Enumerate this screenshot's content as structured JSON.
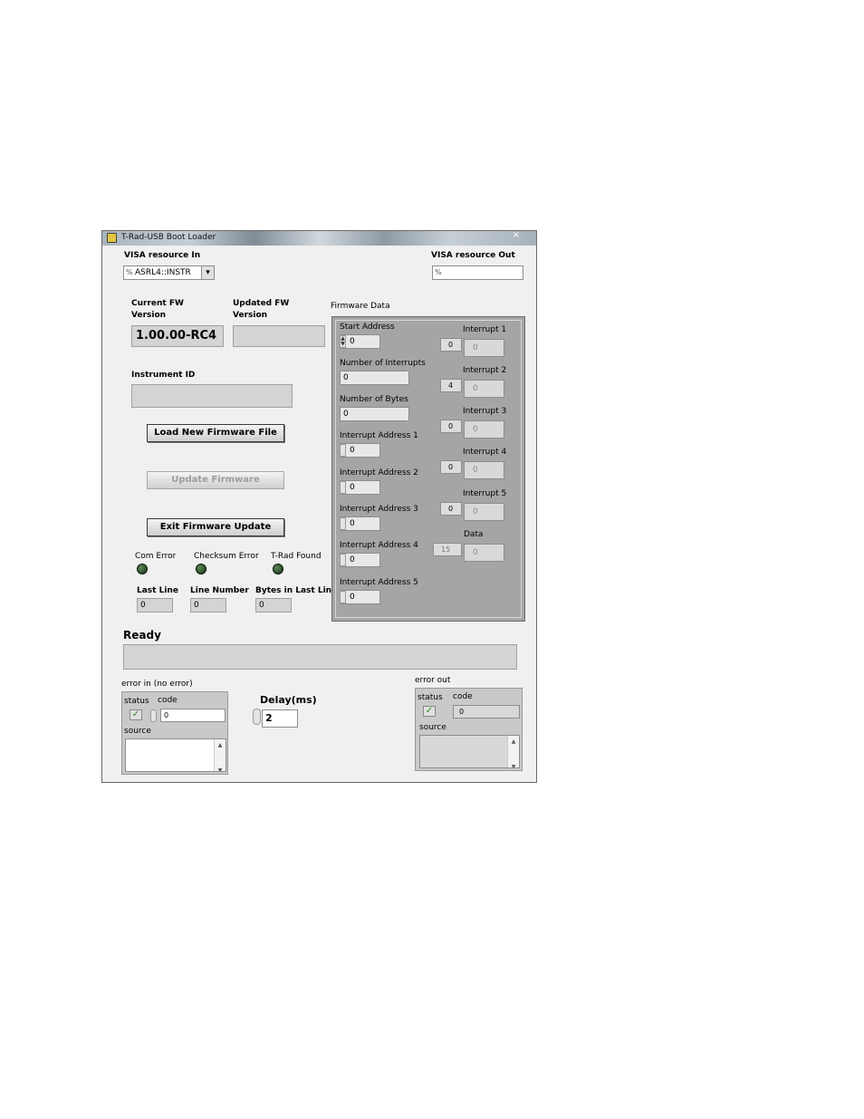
{
  "window": {
    "title": "T-Rad-USB Boot Loader",
    "close_glyph": "×"
  },
  "visa_in": {
    "label": "VISA resource In",
    "value": "ASRL4::INSTR",
    "prefix_icon": "io-resource-icon",
    "dropdown_glyph": "▾"
  },
  "visa_out": {
    "label": "VISA resource Out",
    "value": ""
  },
  "current_fw": {
    "label_line1": "Current FW",
    "label_line2": "Version",
    "value": "1.00.00-RC4"
  },
  "updated_fw": {
    "label_line1": "Updated FW",
    "label_line2": "Version",
    "value": ""
  },
  "instrument_id": {
    "label": "Instrument ID",
    "value": ""
  },
  "buttons": {
    "load": "Load New Firmware File",
    "update": "Update Firmware",
    "exit": "Exit Firmware Update"
  },
  "leds": [
    {
      "label": "Com Error"
    },
    {
      "label": "Checksum Error"
    },
    {
      "label": "T-Rad Found"
    }
  ],
  "counters": [
    {
      "label": "Last Line",
      "value": "0"
    },
    {
      "label": "Line Number",
      "value": "0"
    },
    {
      "label": "Bytes in Last Line",
      "value": "0"
    }
  ],
  "firmware_data": {
    "title": "Firmware Data",
    "start_address": {
      "label": "Start Address",
      "value": "0"
    },
    "num_interrupts": {
      "label": "Number of Interrupts",
      "value": "0"
    },
    "num_bytes": {
      "label": "Number of Bytes",
      "value": "0"
    },
    "interrupt_addresses": [
      {
        "label": "Interrupt Address 1",
        "value": "0"
      },
      {
        "label": "Interrupt Address 2",
        "value": "0"
      },
      {
        "label": "Interrupt Address 3",
        "value": "0"
      },
      {
        "label": "Interrupt Address 4",
        "value": "0"
      },
      {
        "label": "Interrupt Address 5",
        "value": "0"
      }
    ],
    "interrupts": [
      {
        "label": "Interrupt 1",
        "index": "0",
        "value": "0"
      },
      {
        "label": "Interrupt 2",
        "index": "4",
        "value": "0"
      },
      {
        "label": "Interrupt 3",
        "index": "0",
        "value": "0"
      },
      {
        "label": "Interrupt 4",
        "index": "0",
        "value": "0"
      },
      {
        "label": "Interrupt 5",
        "index": "0",
        "value": "0"
      }
    ],
    "data": {
      "label": "Data",
      "index": "15",
      "value": "0"
    }
  },
  "status": {
    "label": "Ready",
    "value": ""
  },
  "error_in": {
    "title": "error in (no error)",
    "status_label": "status",
    "code_label": "code",
    "code_value": "0",
    "source_label": "source",
    "check_glyph": "✓"
  },
  "delay": {
    "label": "Delay(ms)",
    "value": "2"
  },
  "error_out": {
    "title": "error out",
    "status_label": "status",
    "code_label": "code",
    "code_value": "0",
    "source_label": "source",
    "check_glyph": "✓"
  },
  "glyphs": {
    "spin_up": "▲",
    "spin_down": "▼",
    "scroll_up": "▲",
    "scroll_down": "▼"
  }
}
